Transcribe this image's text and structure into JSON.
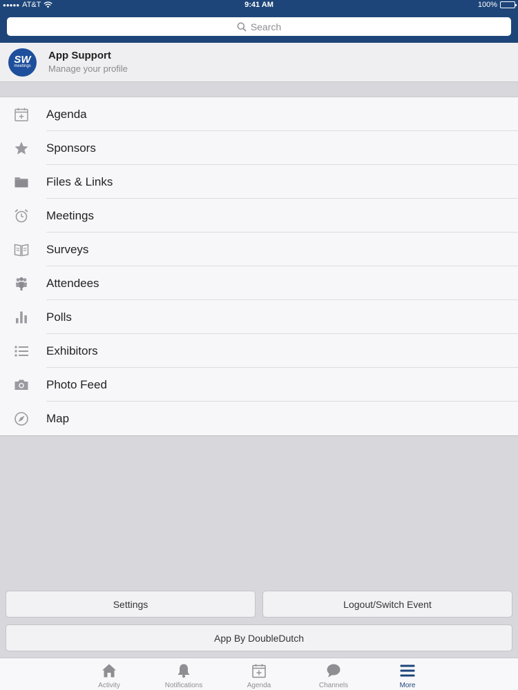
{
  "status_bar": {
    "carrier": "AT&T",
    "time": "9:41 AM",
    "battery": "100%"
  },
  "search": {
    "placeholder": "Search"
  },
  "profile": {
    "avatar_text": "SW",
    "avatar_subtext": "meetings",
    "name": "App Support",
    "subtitle": "Manage your profile"
  },
  "menu": {
    "items": [
      {
        "label": "Agenda",
        "icon": "calendar-icon"
      },
      {
        "label": "Sponsors",
        "icon": "star-icon"
      },
      {
        "label": "Files & Links",
        "icon": "folder-icon"
      },
      {
        "label": "Meetings",
        "icon": "alarm-clock-icon"
      },
      {
        "label": "Surveys",
        "icon": "book-icon"
      },
      {
        "label": "Attendees",
        "icon": "people-icon"
      },
      {
        "label": "Polls",
        "icon": "bar-chart-icon"
      },
      {
        "label": "Exhibitors",
        "icon": "list-icon"
      },
      {
        "label": "Photo Feed",
        "icon": "camera-icon"
      },
      {
        "label": "Map",
        "icon": "compass-icon"
      }
    ]
  },
  "buttons": {
    "settings": "Settings",
    "logout": "Logout/Switch Event",
    "about": "App By DoubleDutch"
  },
  "tabs": [
    {
      "label": "Activity",
      "icon": "home-icon"
    },
    {
      "label": "Notifications",
      "icon": "bell-icon"
    },
    {
      "label": "Agenda",
      "icon": "calendar-icon"
    },
    {
      "label": "Channels",
      "icon": "chat-bubble-icon"
    },
    {
      "label": "More",
      "icon": "menu-icon",
      "active": true
    }
  ],
  "colors": {
    "nav_bar": "#1e4579",
    "icon_gray": "#9a9aa0",
    "active_tab": "#1e4579"
  }
}
